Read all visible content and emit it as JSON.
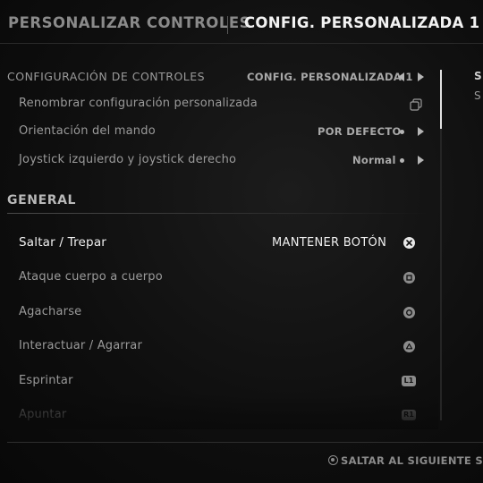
{
  "header": {
    "tab_inactive": "PERSONALIZAR CONTROLES",
    "tab_active": "CONFIG. PERSONALIZADA 1"
  },
  "controls_config": {
    "label": "CONFIGURACIÓN DE CONTROLES",
    "value": "CONFIG. PERSONALIZADA 1",
    "rename": "Renombrar configuración personalizada",
    "orientation_label": "Orientación del mando",
    "orientation_value": "POR DEFECTO",
    "sticks_label": "Joystick izquierdo y joystick derecho",
    "sticks_value": "Normal"
  },
  "general": {
    "title": "GENERAL",
    "items": [
      {
        "label": "Saltar / Trepar",
        "mode": "MANTENER BOTÓN",
        "button": "cross-icon",
        "selected": true
      },
      {
        "label": "Ataque cuerpo a cuerpo",
        "button": "square-icon"
      },
      {
        "label": "Agacharse",
        "button": "circle-icon"
      },
      {
        "label": "Interactuar / Agarrar",
        "button": "triangle-icon"
      },
      {
        "label": "Esprintar",
        "button": "l1-icon",
        "button_text": "L1"
      },
      {
        "label": "Apuntar",
        "button": "r1-icon",
        "button_text": "R1"
      }
    ]
  },
  "footer": {
    "hint": "SALTAR AL SIGUIENTE SIN"
  },
  "side_panel": {
    "letter_1": "S",
    "letter_2": "S"
  },
  "colors": {
    "background": "#0e0e0e",
    "text_primary": "#f2f2f2",
    "text_secondary": "#9a9a9a"
  }
}
